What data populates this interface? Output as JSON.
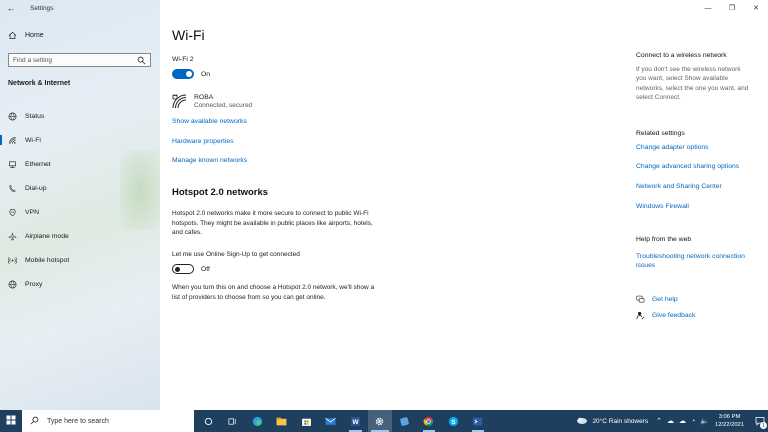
{
  "window": {
    "title": "Settings",
    "back_icon": "back-arrow-icon"
  },
  "sidebar": {
    "home_label": "Home",
    "search_placeholder": "Find a setting",
    "section_heading": "Network & Internet",
    "items": [
      {
        "label": "Status",
        "icon": "globe-icon"
      },
      {
        "label": "Wi-Fi",
        "icon": "wifi-icon",
        "active": true
      },
      {
        "label": "Ethernet",
        "icon": "ethernet-icon"
      },
      {
        "label": "Dial-up",
        "icon": "phone-icon"
      },
      {
        "label": "VPN",
        "icon": "vpn-icon"
      },
      {
        "label": "Airplane mode",
        "icon": "airplane-icon"
      },
      {
        "label": "Mobile hotspot",
        "icon": "hotspot-icon"
      },
      {
        "label": "Proxy",
        "icon": "globe-icon"
      }
    ]
  },
  "main": {
    "title": "Wi-Fi",
    "adapter_label": "Wi-Fi 2",
    "wifi_toggle": {
      "state": "On",
      "on": true
    },
    "network": {
      "name": "ROBA",
      "status": "Connected, secured"
    },
    "links": {
      "show_networks": "Show available networks",
      "hardware": "Hardware properties",
      "manage_known": "Manage known networks"
    },
    "hotspot": {
      "heading": "Hotspot 2.0 networks",
      "description_lines": [
        "Hotspot 2.0 networks make it more secure to connect to public Wi-Fi",
        "hotspots. They might be available in public places like airports, hotels,",
        "and cafes."
      ],
      "signup_label": "Let me use Online Sign-Up to get connected",
      "signup_toggle": {
        "state": "Off",
        "on": false
      },
      "note_lines": [
        "When you turn this on and choose a Hotspot 2.0 network, we'll show a",
        "list of providers to choose from so you can get online."
      ]
    }
  },
  "right": {
    "connect_heading": "Connect to a wireless network",
    "connect_lines": [
      "If you don't see the wireless network",
      "you want, select Show available",
      "networks, select the one you want, and",
      "select Connect."
    ],
    "related_heading": "Related settings",
    "related_links": [
      "Change adapter options",
      "Change advanced sharing options",
      "Network and Sharing Center",
      "Windows Firewall"
    ],
    "help_heading": "Help from the web",
    "help_link_lines": [
      "Troubleshooting network connection",
      "issues"
    ],
    "get_help": "Get help",
    "give_feedback": "Give feedback"
  },
  "taskbar": {
    "search_placeholder": "Type here to search",
    "weather": "20°C  Rain showers",
    "time": "3:06 PM",
    "date": "12/22/2021",
    "notification_count": "1"
  },
  "colors": {
    "accent": "#0067c0",
    "taskbar": "#1f3f5f"
  }
}
